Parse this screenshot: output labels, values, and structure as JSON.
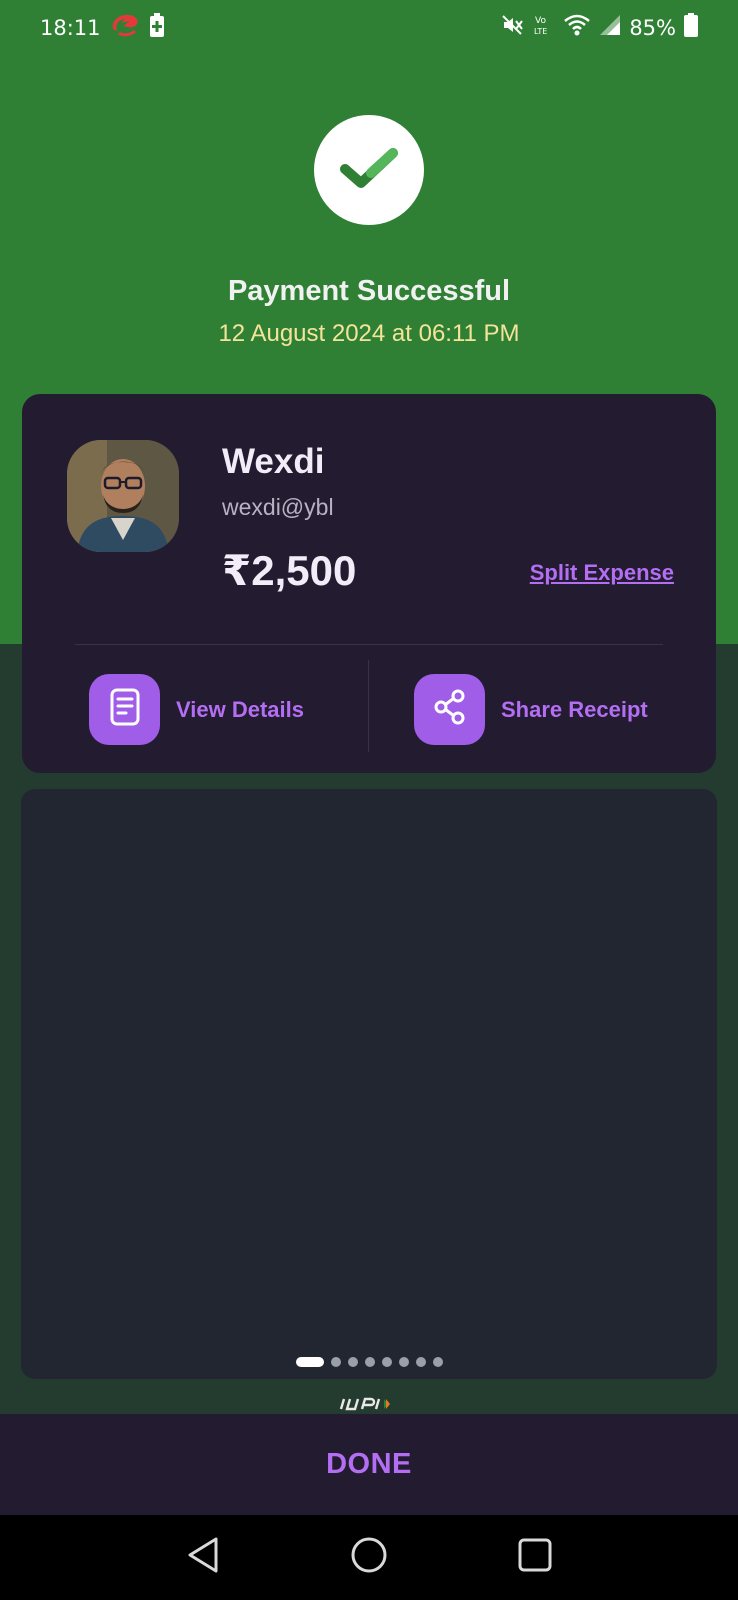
{
  "status_bar": {
    "time": "18:11",
    "battery_percent": "85%",
    "icons": [
      "carrier-icon",
      "battery-saver-icon",
      "mute-icon",
      "volte-icon",
      "wifi-icon",
      "signal-icon",
      "battery-icon"
    ]
  },
  "header": {
    "status_icon": "check-icon",
    "title": "Payment Successful",
    "datetime": "12 August 2024 at 06:11 PM",
    "colors": {
      "background": "#2f8035",
      "datetime": "#f4e49a"
    }
  },
  "payee": {
    "name": "Wexdi",
    "upi_id": "wexdi@ybl",
    "amount": "₹2,500",
    "split_label": "Split Expense"
  },
  "actions": {
    "view_details": {
      "label": "View Details",
      "icon": "document-icon"
    },
    "share_receipt": {
      "label": "Share Receipt",
      "icon": "share-icon"
    }
  },
  "carousel": {
    "page_count": 8,
    "active_page": 1
  },
  "footer": {
    "done_label": "DONE",
    "accent": "#b36ef3"
  },
  "nav": {
    "icons": [
      "back-icon",
      "home-icon",
      "recents-icon"
    ]
  }
}
